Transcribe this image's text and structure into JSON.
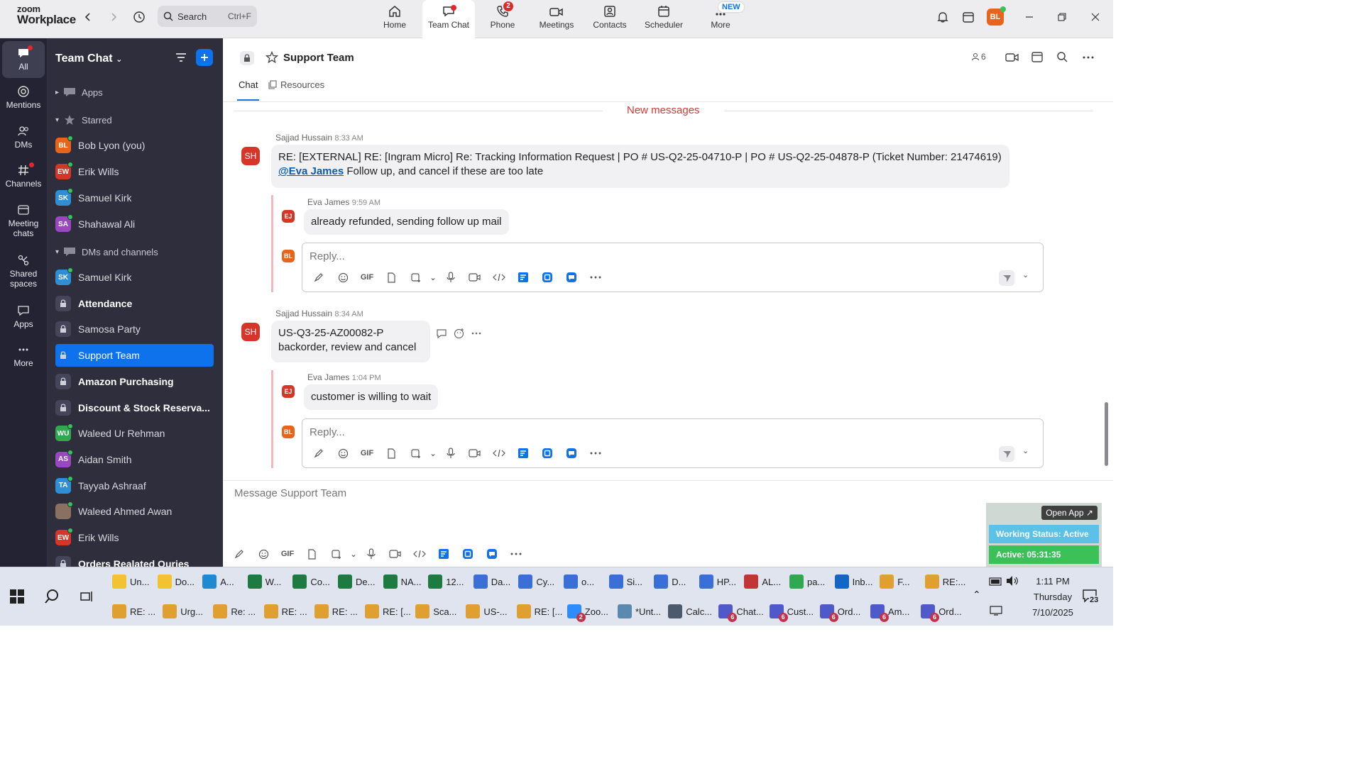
{
  "app": {
    "logo_top": "zoom",
    "logo_bottom": "Workplace"
  },
  "search": {
    "label": "Search",
    "shortcut": "Ctrl+F"
  },
  "tabs": [
    {
      "label": "Home",
      "icon": "home-icon"
    },
    {
      "label": "Team Chat",
      "icon": "chat-icon",
      "active": true
    },
    {
      "label": "Phone",
      "icon": "phone-icon",
      "badge": "2"
    },
    {
      "label": "Meetings",
      "icon": "video-icon"
    },
    {
      "label": "Contacts",
      "icon": "contacts-icon"
    },
    {
      "label": "Scheduler",
      "icon": "calendar-icon"
    },
    {
      "label": "More",
      "icon": "more-icon",
      "badge": "NEW"
    }
  ],
  "user": {
    "initials": "BL",
    "color": "#e8641b"
  },
  "rail": [
    {
      "label": "All"
    },
    {
      "label": "Mentions"
    },
    {
      "label": "DMs"
    },
    {
      "label": "Channels"
    },
    {
      "label": "Meeting chats"
    },
    {
      "label": "Shared spaces"
    },
    {
      "label": "Apps"
    },
    {
      "label": "More"
    }
  ],
  "sidebar": {
    "title": "Team Chat",
    "apps_label": "Apps",
    "starred_label": "Starred",
    "dms_label": "DMs and channels",
    "starred": [
      {
        "initials": "BL",
        "name": "Bob Lyon (you)",
        "color": "#e8641b"
      },
      {
        "initials": "EW",
        "name": "Erik Wills",
        "color": "#d6362a"
      },
      {
        "initials": "SK",
        "name": "Samuel Kirk",
        "color": "#2f8fd6"
      },
      {
        "initials": "SA",
        "name": "Shahawal Ali",
        "color": "#9a48c2"
      }
    ],
    "dms": [
      {
        "initials": "SK",
        "name": "Samuel Kirk",
        "color": "#2f8fd6"
      },
      {
        "channel": true,
        "name": "Attendance",
        "bold": true
      },
      {
        "channel": true,
        "name": "Samosa Party"
      },
      {
        "channel": true,
        "name": "Support Team",
        "selected": true
      },
      {
        "channel": true,
        "name": "Amazon Purchasing",
        "bold": true
      },
      {
        "channel": true,
        "name": "Discount & Stock Reserva...",
        "bold": true
      },
      {
        "initials": "WU",
        "name": "Waleed Ur Rehman",
        "color": "#2fa84f"
      },
      {
        "initials": "AS",
        "name": "Aidan Smith",
        "color": "#9a48c2"
      },
      {
        "initials": "TA",
        "name": "Tayyab Ashraaf",
        "color": "#2f8fd6"
      },
      {
        "initials": "",
        "name": "Waleed Ahmed Awan",
        "color": "#8a7060"
      },
      {
        "initials": "EW",
        "name": "Erik Wills",
        "color": "#d6362a"
      },
      {
        "channel": true,
        "name": "Orders Realated Ouries",
        "bold": true
      }
    ]
  },
  "channel": {
    "name": "Support Team",
    "member_count": "6",
    "tab_chat": "Chat",
    "tab_resources": "Resources",
    "new_messages": "New messages"
  },
  "messages": [
    {
      "sender": "Sajjad Hussain",
      "time": "8:33 AM",
      "initials": "SH",
      "line1": "RE: [EXTERNAL] RE: [Ingram Micro] Re: Tracking Information Request | PO # US-Q2-25-04710-P | PO # US-Q2-25-04878-P (Ticket Number: 21474619)",
      "mention": "@Eva James",
      "line2": " Follow up, and cancel if these are too late",
      "reply": {
        "sender": "Eva James",
        "time": "9:59 AM",
        "initials": "EJ",
        "text": "already refunded, sending follow up mail"
      }
    },
    {
      "sender": "Sajjad Hussain",
      "time": "8:34 AM",
      "initials": "SH",
      "line1": "US-Q3-25-AZ00082-P",
      "line2": "backorder, review and cancel",
      "reply": {
        "sender": "Eva James",
        "time": "1:04 PM",
        "initials": "EJ",
        "text": "customer is willing to wait"
      }
    }
  ],
  "reply_placeholder": "Reply...",
  "gif_label": "GIF",
  "compose_placeholder": "Message Support Team",
  "widget": {
    "open_app": "Open App ↗",
    "status": "Working Status: Active",
    "timer": "Active: 05:31:35"
  },
  "taskbar": {
    "row1": [
      {
        "label": "Un...",
        "color": "#f2c230"
      },
      {
        "label": "Do...",
        "color": "#f2c230"
      },
      {
        "label": "A...",
        "color": "#1f8ad2"
      },
      {
        "label": "W...",
        "color": "#1d7a40"
      },
      {
        "label": "Co...",
        "color": "#1d7a40"
      },
      {
        "label": "De...",
        "color": "#1d7a40"
      },
      {
        "label": "NA...",
        "color": "#1d7a40"
      },
      {
        "label": "12...",
        "color": "#1d7a40"
      },
      {
        "label": "Da...",
        "color": "#3a6fd8"
      },
      {
        "label": "Cy...",
        "color": "#3a6fd8"
      },
      {
        "label": "o...",
        "color": "#3a6fd8"
      },
      {
        "label": "Si...",
        "color": "#3a6fd8"
      },
      {
        "label": "D...",
        "color": "#3a6fd8"
      },
      {
        "label": "HP...",
        "color": "#3a6fd8"
      },
      {
        "label": "AL...",
        "color": "#c23535"
      },
      {
        "label": "pa...",
        "color": "#2fa84f"
      },
      {
        "label": "Inb...",
        "color": "#1366c3"
      },
      {
        "label": "F...",
        "color": "#e0a030"
      },
      {
        "label": "RE:...",
        "color": "#e0a030"
      }
    ],
    "row2": [
      {
        "label": "RE: ...",
        "color": "#e0a030"
      },
      {
        "label": "Urg...",
        "color": "#e0a030"
      },
      {
        "label": "Re: ...",
        "color": "#e0a030"
      },
      {
        "label": "RE: ...",
        "color": "#e0a030"
      },
      {
        "label": "RE: ...",
        "color": "#e0a030"
      },
      {
        "label": "RE: [...",
        "color": "#e0a030"
      },
      {
        "label": "Sca...",
        "color": "#e0a030"
      },
      {
        "label": "US-...",
        "color": "#e0a030"
      },
      {
        "label": "RE: [...",
        "color": "#e0a030"
      },
      {
        "label": "Zoo...",
        "color": "#2d8cff",
        "badge": "2"
      },
      {
        "label": "*Unt...",
        "color": "#5a8ab0"
      },
      {
        "label": "Calc...",
        "color": "#4b5a6c"
      },
      {
        "label": "Chat...",
        "color": "#5059c9",
        "badge": "6"
      },
      {
        "label": "Cust...",
        "color": "#5059c9",
        "badge": "6"
      },
      {
        "label": "Ord...",
        "color": "#5059c9",
        "badge": "6"
      },
      {
        "label": "Am...",
        "color": "#5059c9",
        "badge": "6"
      },
      {
        "label": "Ord...",
        "color": "#5059c9",
        "badge": "6"
      }
    ],
    "time": "1:11 PM",
    "day": "Thursday",
    "date": "7/10/2025",
    "notifications": "23"
  }
}
